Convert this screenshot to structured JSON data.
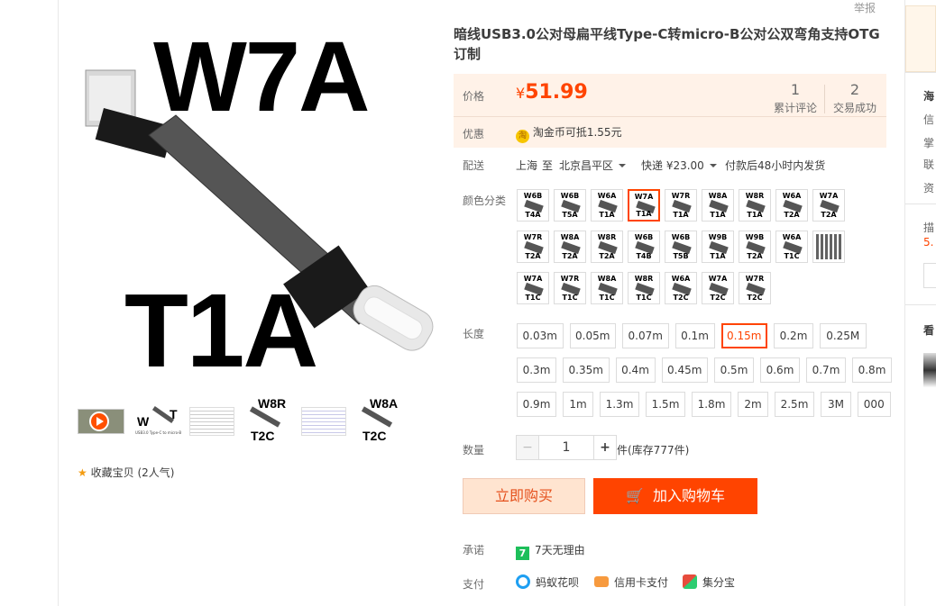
{
  "top": {
    "report_label": "举报"
  },
  "gallery": {
    "main_text_top": "W7A",
    "main_text_bottom": "T1A",
    "thumbs": [
      {
        "name": "video",
        "label": ""
      },
      {
        "name": "wt",
        "top": "W",
        "right": "T",
        "caption": "USB3.0 Type-C to micro-B"
      },
      {
        "name": "table1",
        "label": ""
      },
      {
        "name": "w8r",
        "top": "W8R",
        "bottom": "T2C"
      },
      {
        "name": "table2",
        "label": ""
      },
      {
        "name": "w8a",
        "top": "W8A",
        "bottom": "T2C"
      }
    ],
    "favorite": {
      "label": "收藏宝贝",
      "count": "(2人气)"
    }
  },
  "product": {
    "title": "暗线USB3.0公对母扁平线Type-C转micro-B公对公双弯角支持OTG订制",
    "price_label": "价格",
    "currency": "¥",
    "price": "51.99",
    "reviews_count": "1",
    "reviews_label": "累计评论",
    "sales_count": "2",
    "sales_label": "交易成功",
    "promo_label": "优惠",
    "promo_text": "淘金币可抵",
    "promo_amount": "1.55元",
    "delivery_label": "配送",
    "delivery_from": "上海",
    "delivery_to_word": "至",
    "delivery_to": "北京昌平区",
    "shipping": "快递 ¥23.00",
    "ship_time": "付款后48小时内发货",
    "color_label": "颜色分类",
    "colors": [
      {
        "top": "W6B",
        "bottom": "T4A",
        "selected": false
      },
      {
        "top": "W6B",
        "bottom": "T5A",
        "selected": false
      },
      {
        "top": "W6A",
        "bottom": "T1A",
        "selected": false
      },
      {
        "top": "W7A",
        "bottom": "T1A",
        "selected": true
      },
      {
        "top": "W7R",
        "bottom": "T1A",
        "selected": false
      },
      {
        "top": "W8A",
        "bottom": "T1A",
        "selected": false
      },
      {
        "top": "W8R",
        "bottom": "T1A",
        "selected": false
      },
      {
        "top": "W6A",
        "bottom": "T2A",
        "selected": false
      },
      {
        "top": "W7A",
        "bottom": "T2A",
        "selected": false
      },
      {
        "top": "W7R",
        "bottom": "T2A",
        "selected": false
      },
      {
        "top": "W8A",
        "bottom": "T2A",
        "selected": false
      },
      {
        "top": "W8R",
        "bottom": "T2A",
        "selected": false
      },
      {
        "top": "W6B",
        "bottom": "T4B",
        "selected": false
      },
      {
        "top": "W6B",
        "bottom": "T5B",
        "selected": false
      },
      {
        "top": "W9B",
        "bottom": "T1A",
        "selected": false
      },
      {
        "top": "W9B",
        "bottom": "T2A",
        "selected": false
      },
      {
        "top": "W6A",
        "bottom": "T1C",
        "selected": false
      },
      {
        "top": "",
        "bottom": "",
        "selected": false
      },
      {
        "top": "W7A",
        "bottom": "T1C",
        "selected": false
      },
      {
        "top": "W7R",
        "bottom": "T1C",
        "selected": false
      },
      {
        "top": "W8A",
        "bottom": "T1C",
        "selected": false
      },
      {
        "top": "W8R",
        "bottom": "T1C",
        "selected": false
      },
      {
        "top": "W6A",
        "bottom": "T2C",
        "selected": false
      },
      {
        "top": "W7A",
        "bottom": "T2C",
        "selected": false
      },
      {
        "top": "W7R",
        "bottom": "T2C",
        "selected": false
      }
    ],
    "length_label": "长度",
    "lengths": [
      "0.03m",
      "0.05m",
      "0.07m",
      "0.1m",
      "0.15m",
      "0.2m",
      "0.25M",
      "0.3m",
      "0.35m",
      "0.4m",
      "0.45m",
      "0.5m",
      "0.6m",
      "0.7m",
      "0.8m",
      "0.9m",
      "1m",
      "1.3m",
      "1.5m",
      "1.8m",
      "2m",
      "2.5m",
      "3M",
      "000"
    ],
    "selected_length": "0.15m",
    "qty_label": "数量",
    "qty_minus": "−",
    "qty_value": "1",
    "qty_plus": "+",
    "stock": "件(库存777件)",
    "buy_now": "立即购买",
    "add_cart": "加入购物车",
    "promise_label": "承诺",
    "promise_icon": "7",
    "promise_text": "7天无理由",
    "pay_label": "支付",
    "pay_methods": [
      "蚂蚁花呗",
      "信用卡支付",
      "集分宝"
    ]
  },
  "side": {
    "items": [
      "海",
      "信",
      "掌",
      "联",
      "资",
      "描",
      "5.",
      "看"
    ]
  },
  "colors": {
    "accent": "#ff4400",
    "price": "#ff4400",
    "price_bg": "#fff2e8"
  }
}
